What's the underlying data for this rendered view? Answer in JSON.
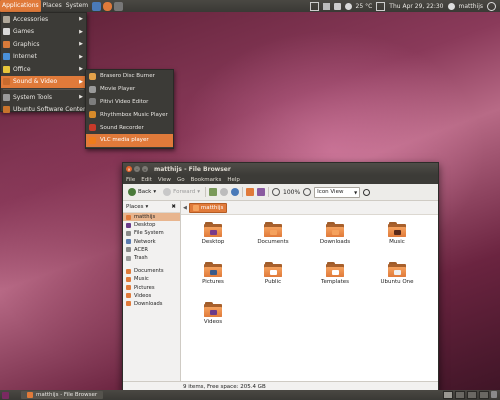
{
  "top_panel": {
    "menus": [
      "Applications",
      "Places",
      "System"
    ],
    "clock": "Thu Apr 29, 22:30",
    "temperature": "25 °C",
    "user": "matthijs"
  },
  "applications_menu": {
    "items": [
      {
        "label": "Accessories",
        "icon": "accessories-icon",
        "color": "#b0a89a"
      },
      {
        "label": "Games",
        "icon": "games-icon",
        "color": "#d9d9d9"
      },
      {
        "label": "Graphics",
        "icon": "graphics-icon",
        "color": "#d97a3a"
      },
      {
        "label": "Internet",
        "icon": "internet-icon",
        "color": "#4a90d9"
      },
      {
        "label": "Office",
        "icon": "office-icon",
        "color": "#e7c53a"
      },
      {
        "label": "Sound & Video",
        "icon": "sound-video-icon",
        "color": "#c86b2e"
      },
      {
        "label": "System Tools",
        "icon": "system-tools-icon",
        "color": "#9a9a9a"
      },
      {
        "label": "Ubuntu Software Center",
        "icon": "software-center-icon",
        "color": "#c8742c"
      }
    ],
    "active_index": 5
  },
  "sound_video_menu": {
    "items": [
      {
        "label": "Brasero Disc Burner",
        "icon": "brasero-icon",
        "color": "#e3a24a"
      },
      {
        "label": "Movie Player",
        "icon": "movie-player-icon",
        "color": "#9a9a9a"
      },
      {
        "label": "Pitivi Video Editor",
        "icon": "pitivi-icon",
        "color": "#7d7d7d"
      },
      {
        "label": "Rhythmbox Music Player",
        "icon": "rhythmbox-icon",
        "color": "#d78a2a"
      },
      {
        "label": "Sound Recorder",
        "icon": "sound-recorder-icon",
        "color": "#c83a2a"
      },
      {
        "label": "VLC media player",
        "icon": "vlc-icon",
        "color": "#f07c1a"
      }
    ],
    "active_index": 5
  },
  "file_browser": {
    "title": "matthijs - File Browser",
    "menubar": [
      "File",
      "Edit",
      "View",
      "Go",
      "Bookmarks",
      "Help"
    ],
    "toolbar": {
      "back": "Back",
      "forward": "Forward",
      "zoom": "100%",
      "view_mode": "Icon View"
    },
    "sidebar": {
      "header": "Places",
      "items": [
        {
          "label": "matthijs",
          "icon": "home-icon",
          "color": "#e07a3a"
        },
        {
          "label": "Desktop",
          "icon": "desktop-icon",
          "color": "#6a3a8a"
        },
        {
          "label": "File System",
          "icon": "filesystem-icon",
          "color": "#8a8a8a"
        },
        {
          "label": "Network",
          "icon": "network-icon",
          "color": "#5a7ab0"
        },
        {
          "label": "ACER",
          "icon": "drive-icon",
          "color": "#8a8a8a"
        },
        {
          "label": "Trash",
          "icon": "trash-icon",
          "color": "#9a9a9a"
        },
        {
          "label": "Documents",
          "icon": "folder-icon",
          "color": "#e07a3a"
        },
        {
          "label": "Music",
          "icon": "folder-icon",
          "color": "#e07a3a"
        },
        {
          "label": "Pictures",
          "icon": "folder-icon",
          "color": "#e07a3a"
        },
        {
          "label": "Videos",
          "icon": "folder-icon",
          "color": "#e07a3a"
        },
        {
          "label": "Downloads",
          "icon": "folder-icon",
          "color": "#e07a3a"
        }
      ],
      "active_index": 0
    },
    "path_chip": "matthijs",
    "folders": [
      {
        "label": "Desktop",
        "icon": "desktop-folder-icon",
        "emblem": "#7a3a8a"
      },
      {
        "label": "Documents",
        "icon": "documents-folder-icon",
        "emblem": "#f5a25e"
      },
      {
        "label": "Downloads",
        "icon": "downloads-folder-icon",
        "emblem": "#f5a25e"
      },
      {
        "label": "Music",
        "icon": "music-folder-icon",
        "emblem": "#5a2a1a"
      },
      {
        "label": "Pictures",
        "icon": "pictures-folder-icon",
        "emblem": "#3a5a8a"
      },
      {
        "label": "Public",
        "icon": "public-folder-icon",
        "emblem": "#ffffff"
      },
      {
        "label": "Templates",
        "icon": "templates-folder-icon",
        "emblem": "#ffffff"
      },
      {
        "label": "Ubuntu One",
        "icon": "ubuntu-one-folder-icon",
        "emblem": "#f0f0f0"
      },
      {
        "label": "Videos",
        "icon": "videos-folder-icon",
        "emblem": "#6a3a8a"
      }
    ],
    "status": "9 items, Free space: 205.4 GB"
  },
  "bottom_panel": {
    "task": "matthijs - File Browser"
  },
  "colors": {
    "accent": "#e07a3a",
    "panel": "#3c3b37"
  }
}
